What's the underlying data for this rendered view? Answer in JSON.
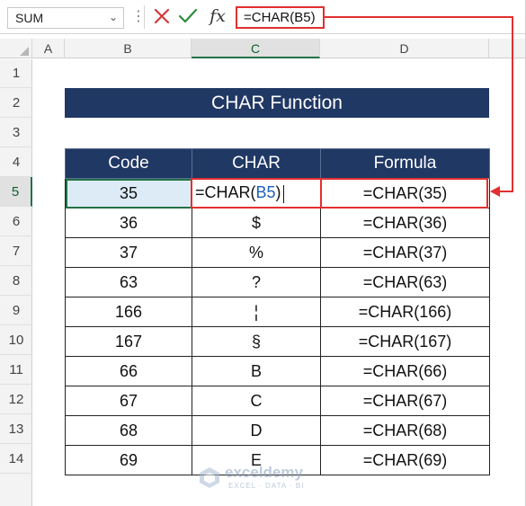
{
  "formula_bar": {
    "name_box": "SUM",
    "name_box_arrow": "⌄",
    "dots": "⋮",
    "cancel_icon": "cancel-icon",
    "enter_icon": "enter-icon",
    "fx_label": "fx",
    "formula": "=CHAR(B5)"
  },
  "columns": [
    "A",
    "B",
    "C",
    "D"
  ],
  "selected_column": "C",
  "rows": [
    "1",
    "2",
    "3",
    "4",
    "5",
    "6",
    "7",
    "8",
    "9",
    "10",
    "11",
    "12",
    "13",
    "14"
  ],
  "selected_row": "5",
  "title": "CHAR Function",
  "table": {
    "headers": [
      "Code",
      "CHAR",
      "Formula"
    ],
    "editing_cell": {
      "prefix": "=CHAR(",
      "ref": "B5",
      "suffix": ")"
    },
    "rows": [
      {
        "code": "35",
        "char": "",
        "formula": "=CHAR(35)"
      },
      {
        "code": "36",
        "char": "$",
        "formula": "=CHAR(36)"
      },
      {
        "code": "37",
        "char": "%",
        "formula": "=CHAR(37)"
      },
      {
        "code": "63",
        "char": "?",
        "formula": "=CHAR(63)"
      },
      {
        "code": "166",
        "char": "¦",
        "formula": "=CHAR(166)"
      },
      {
        "code": "167",
        "char": "§",
        "formula": "=CHAR(167)"
      },
      {
        "code": "66",
        "char": "B",
        "formula": "=CHAR(66)"
      },
      {
        "code": "67",
        "char": "C",
        "formula": "=CHAR(67)"
      },
      {
        "code": "68",
        "char": "D",
        "formula": "=CHAR(68)"
      },
      {
        "code": "69",
        "char": "E",
        "formula": "=CHAR(69)"
      }
    ]
  },
  "watermark": {
    "name": "exceldemy",
    "tagline": "EXCEL · DATA · BI"
  },
  "colors": {
    "header_fill": "#203864",
    "highlight": "#e23030",
    "excel_green": "#217346"
  }
}
